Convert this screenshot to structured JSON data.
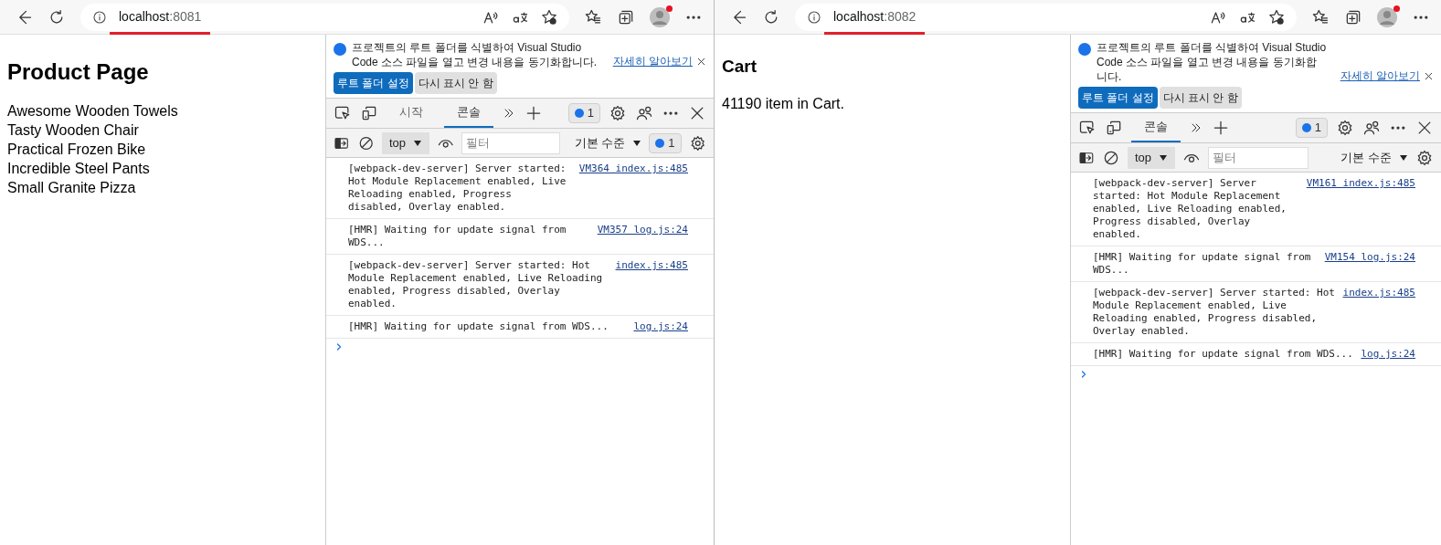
{
  "windows": [
    {
      "address": {
        "host": "localhost",
        "port": ":8081"
      },
      "page": {
        "blocks": [
          {
            "kind": "title",
            "text": "Product Page"
          },
          {
            "kind": "list",
            "items": [
              "Awesome Wooden Towels",
              "Tasty Wooden Chair",
              "Practical Frozen Bike",
              "Incredible Steel Pants",
              "Small Granite Pizza"
            ]
          }
        ]
      },
      "devtools": {
        "banner": {
          "message": "프로젝트의 루트 폴더를 식별하여 Visual Studio Code 소스 파일을 열고 변경 내용을 동기화합니다.",
          "link": "자세히 알아보기",
          "buttons": [
            {
              "label": "루트 폴더 설정",
              "kind": "primary"
            },
            {
              "label": "다시 표시 안 함",
              "kind": "secondary"
            }
          ]
        },
        "tabs": [
          {
            "label": "시작",
            "selected": false
          },
          {
            "label": "콘솔",
            "selected": true
          }
        ],
        "issues_badge": "1",
        "console_toolbar": {
          "context": "top",
          "filter_placeholder": "필터",
          "level": "기본 수준",
          "issues_badge": "1"
        },
        "messages": [
          {
            "text": "[webpack-dev-server] Server started: Hot Module Replacement enabled, Live Reloading enabled, Progress disabled, Overlay enabled.",
            "source": "VM364 index.js:485"
          },
          {
            "text": "[HMR] Waiting for update signal from WDS...",
            "source": "VM357 log.js:24"
          },
          {
            "text": "[webpack-dev-server] Server started: Hot Module Replacement enabled, Live Reloading enabled, Progress disabled, Overlay enabled.",
            "source": "index.js:485"
          },
          {
            "text": "[HMR] Waiting for update signal from WDS...",
            "source": "log.js:24"
          }
        ]
      }
    },
    {
      "address": {
        "host": "localhost",
        "port": ":8082"
      },
      "page": {
        "blocks": [
          {
            "kind": "heading",
            "text": "Cart"
          },
          {
            "kind": "paragraph",
            "text": "41190 item in Cart."
          }
        ]
      },
      "devtools": {
        "banner": {
          "message": "프로젝트의 루트 폴더를 식별하여 Visual Studio Code 소스 파일을 열고 변경 내용을 동기화합니다.",
          "link": "자세히 알아보기",
          "buttons": [
            {
              "label": "루트 폴더 설정",
              "kind": "primary"
            },
            {
              "label": "다시 표시 안 함",
              "kind": "secondary"
            }
          ]
        },
        "tabs": [
          {
            "label": "콘솔",
            "selected": true
          }
        ],
        "issues_badge": "1",
        "console_toolbar": {
          "context": "top",
          "filter_placeholder": "필터",
          "level": "기본 수준"
        },
        "messages": [
          {
            "text": "[webpack-dev-server] Server started: Hot Module Replacement enabled, Live Reloading enabled, Progress disabled, Overlay enabled.",
            "source": "VM161 index.js:485"
          },
          {
            "text": "[HMR] Waiting for update signal from WDS...",
            "source": "VM154 log.js:24"
          },
          {
            "text": "[webpack-dev-server] Server started: Hot Module Replacement enabled, Live Reloading enabled, Progress disabled, Overlay enabled.",
            "source": "index.js:485"
          },
          {
            "text": "[HMR] Waiting for update signal from WDS...",
            "source": "log.js:24"
          }
        ]
      }
    }
  ]
}
